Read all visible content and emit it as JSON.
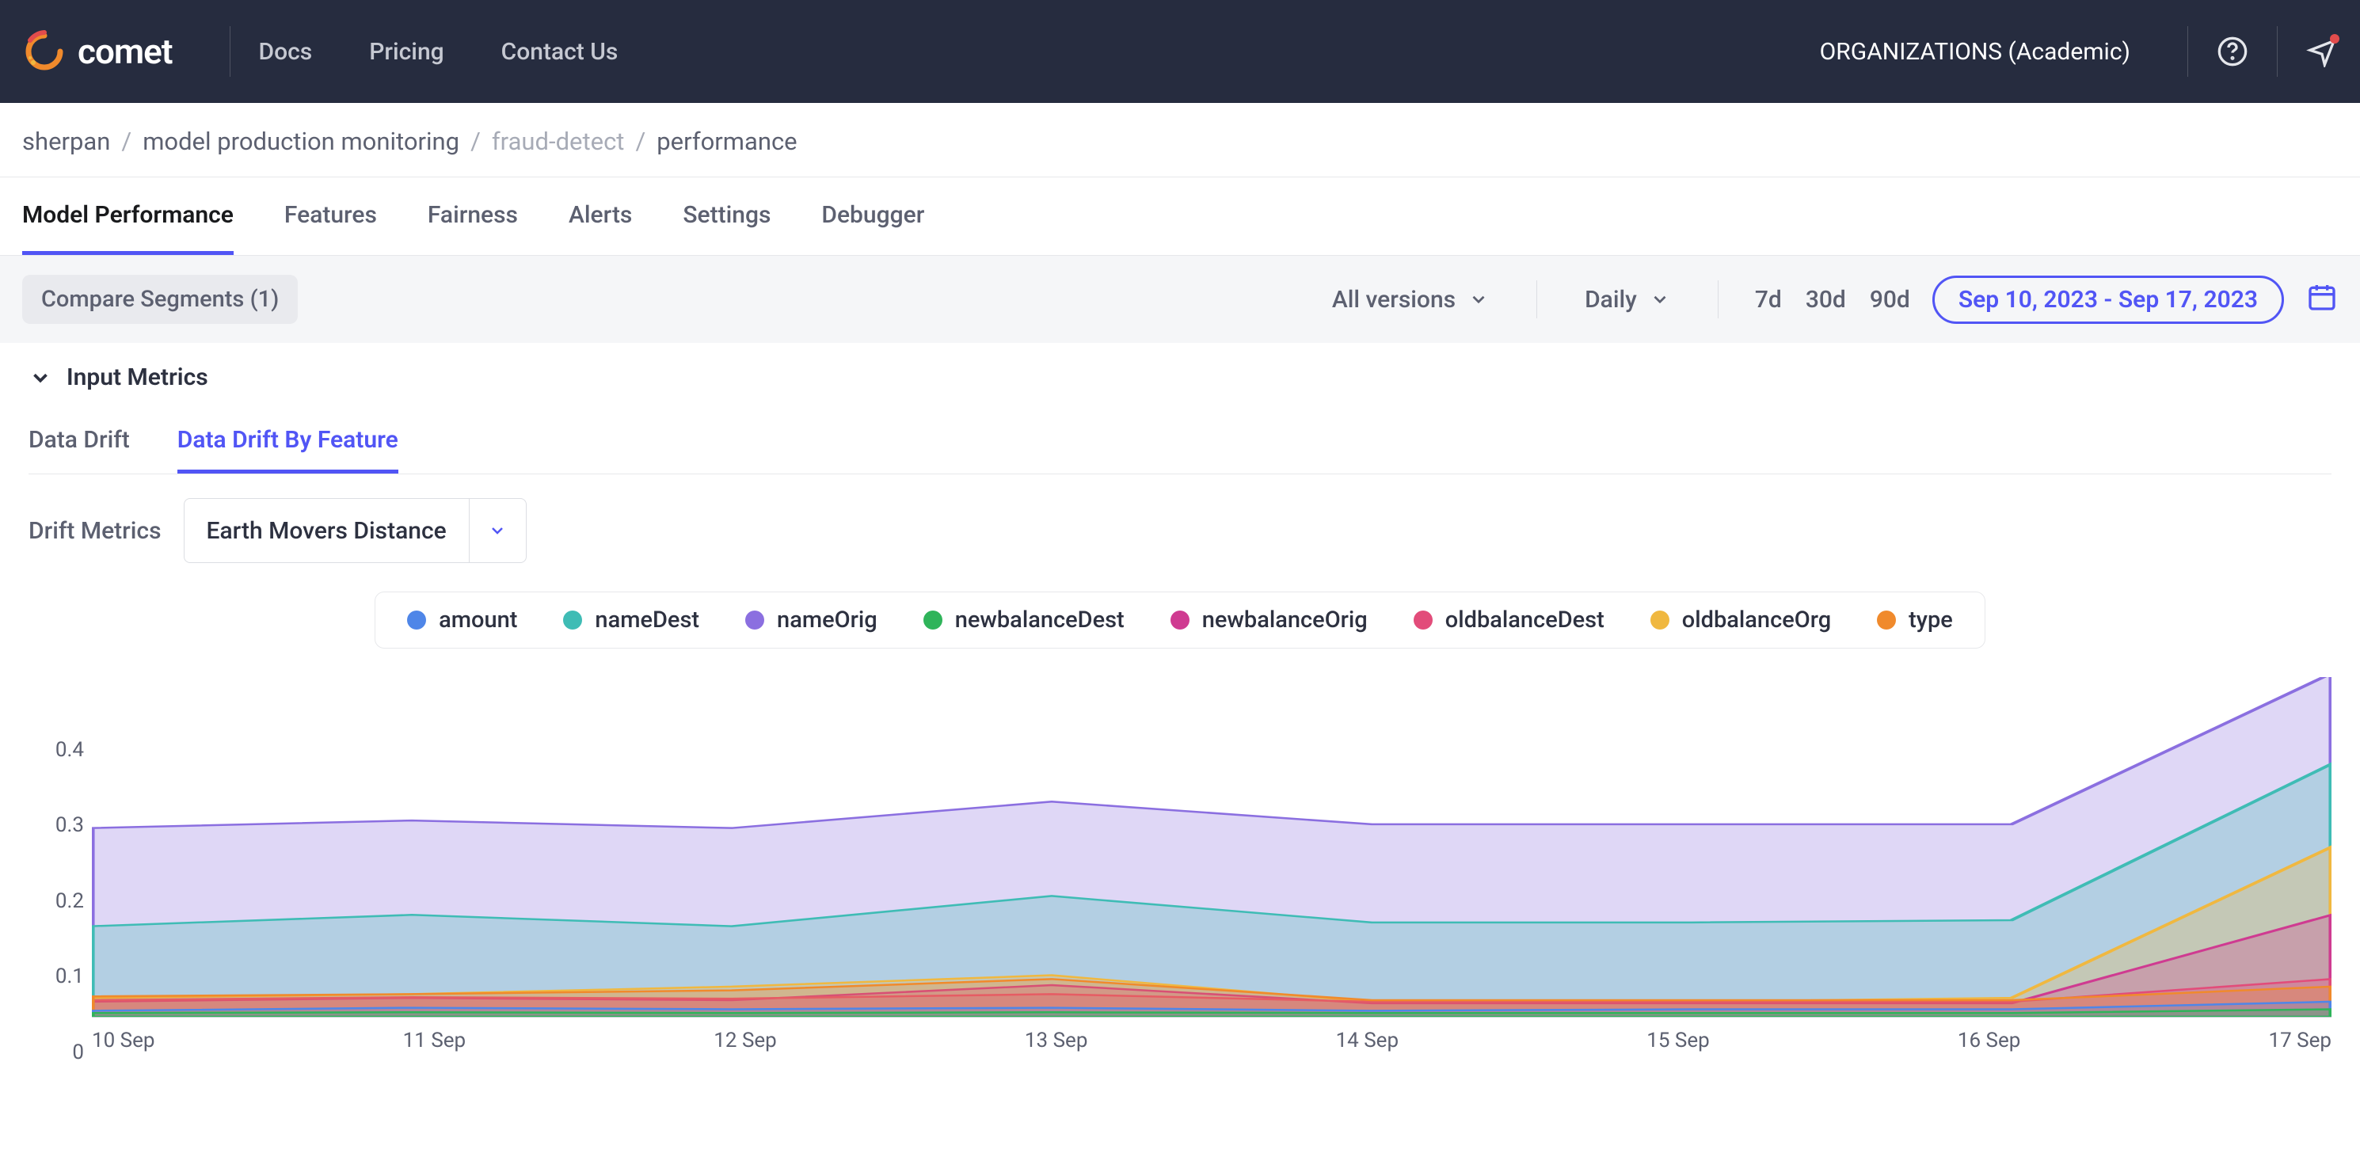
{
  "header": {
    "brand": "comet",
    "links": [
      "Docs",
      "Pricing",
      "Contact Us"
    ],
    "org_label": "ORGANIZATIONS (Academic)"
  },
  "breadcrumb": {
    "a": "sherpan",
    "b": "model production monitoring",
    "c": "fraud-detect",
    "d": "performance"
  },
  "tabs": [
    "Model Performance",
    "Features",
    "Fairness",
    "Alerts",
    "Settings",
    "Debugger"
  ],
  "active_tab": "Model Performance",
  "toolbar": {
    "compare_segments": "Compare Segments (1)",
    "versions": "All versions",
    "interval": "Daily",
    "ranges": [
      "7d",
      "30d",
      "90d"
    ],
    "date_range": "Sep 10, 2023 - Sep 17, 2023"
  },
  "panel": {
    "section_title": "Input Metrics",
    "sub_tabs": [
      "Data Drift",
      "Data Drift By Feature"
    ],
    "active_sub_tab": "Data Drift By Feature",
    "drift_label": "Drift Metrics",
    "drift_value": "Earth Movers Distance"
  },
  "chart_data": {
    "type": "area",
    "title": "",
    "xlabel": "",
    "ylabel": "",
    "ylim": [
      0,
      0.45
    ],
    "categories": [
      "10 Sep",
      "11 Sep",
      "12 Sep",
      "13 Sep",
      "14 Sep",
      "15 Sep",
      "16 Sep",
      "17 Sep"
    ],
    "y_ticks": [
      0,
      0.1,
      0.2,
      0.3,
      0.4
    ],
    "series": [
      {
        "name": "amount",
        "color": "#4f86e8",
        "values": [
          0.008,
          0.012,
          0.01,
          0.012,
          0.008,
          0.01,
          0.01,
          0.02
        ]
      },
      {
        "name": "nameDest",
        "color": "#3fbcb5",
        "values": [
          0.12,
          0.135,
          0.12,
          0.16,
          0.125,
          0.125,
          0.128,
          0.335
        ]
      },
      {
        "name": "nameOrig",
        "color": "#8b6fe0",
        "values": [
          0.25,
          0.26,
          0.25,
          0.285,
          0.255,
          0.255,
          0.255,
          0.455
        ]
      },
      {
        "name": "newbalanceDest",
        "color": "#2fb45a",
        "values": [
          0.005,
          0.006,
          0.005,
          0.006,
          0.005,
          0.005,
          0.005,
          0.01
        ]
      },
      {
        "name": "newbalanceOrig",
        "color": "#cf3b91",
        "values": [
          0.02,
          0.025,
          0.022,
          0.042,
          0.018,
          0.018,
          0.018,
          0.135
        ]
      },
      {
        "name": "oldbalanceDest",
        "color": "#e24c7a",
        "values": [
          0.022,
          0.026,
          0.024,
          0.03,
          0.02,
          0.02,
          0.02,
          0.05
        ]
      },
      {
        "name": "oldbalanceOrg",
        "color": "#f0b840",
        "values": [
          0.025,
          0.03,
          0.04,
          0.055,
          0.02,
          0.02,
          0.025,
          0.225
        ]
      },
      {
        "name": "type",
        "color": "#f08a2c",
        "values": [
          0.027,
          0.03,
          0.035,
          0.05,
          0.022,
          0.022,
          0.022,
          0.04
        ]
      }
    ]
  }
}
